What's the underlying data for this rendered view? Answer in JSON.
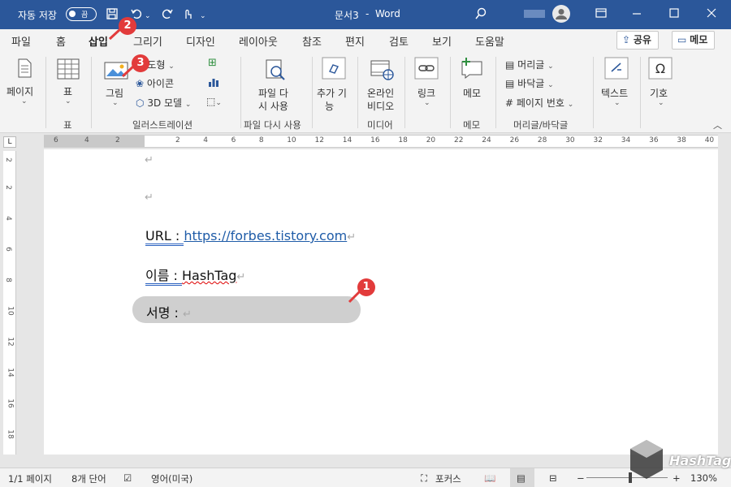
{
  "titlebar": {
    "autosave_label": "자동 저장",
    "autosave_state": "끔",
    "doc_title": "문서3",
    "app_name": "Word",
    "separator": "-"
  },
  "tabs": [
    {
      "label": "파일"
    },
    {
      "label": "홈"
    },
    {
      "label": "삽입"
    },
    {
      "label": "그리기"
    },
    {
      "label": "디자인"
    },
    {
      "label": "레이아웃"
    },
    {
      "label": "참조"
    },
    {
      "label": "편지"
    },
    {
      "label": "검토"
    },
    {
      "label": "보기"
    },
    {
      "label": "도움말"
    }
  ],
  "share_label": "공유",
  "comments_label": "메모",
  "ribbon": {
    "pages": "페이지",
    "table": "표",
    "table_group": "표",
    "pictures": "그림",
    "shapes": "도형",
    "icons": "아이콘",
    "models3d": "3D 모델",
    "illustrations_group": "일러스트레이션",
    "reuse_line1": "파일 다",
    "reuse_line2": "시 사용",
    "reuse_group": "파일 다시 사용",
    "addins_line1": "추가 기",
    "addins_line2": "능",
    "online_video_line1": "온라인",
    "online_video_line2": "비디오",
    "media_group": "미디어",
    "link": "링크",
    "comment": "메모",
    "comment_group": "메모",
    "header": "머리글",
    "footer": "바닥글",
    "page_number": "페이지 번호",
    "header_footer_group": "머리글/바닥글",
    "text": "텍스트",
    "symbols": "기호"
  },
  "ruler_h_numbers": [
    "6",
    "4",
    "2",
    "2",
    "4",
    "6",
    "8",
    "10",
    "12",
    "14",
    "16",
    "18",
    "20",
    "22",
    "24",
    "26",
    "28",
    "30",
    "32",
    "34",
    "36",
    "38",
    "40"
  ],
  "ruler_v_numbers": [
    "2",
    "2",
    "4",
    "6",
    "8",
    "10",
    "12",
    "14",
    "16",
    "18"
  ],
  "document": {
    "url_label": "URL",
    "colon": " : ",
    "url_value": "https://forbes.tistory.com",
    "name_label": "이름",
    "name_value": "HashTag",
    "sign_label": "서명",
    "para_mark": "↵"
  },
  "badges": [
    "1",
    "2",
    "3"
  ],
  "status": {
    "page": "1/1 페이지",
    "words": "8개 단어",
    "language": "영어(미국)",
    "focus": "포커스",
    "zoom": "130%",
    "minus": "−",
    "plus": "+"
  },
  "watermark": "HashTag",
  "colors": {
    "titlebar": "#2b579a",
    "badge": "#e23b3b",
    "link": "#1f5ca8"
  }
}
